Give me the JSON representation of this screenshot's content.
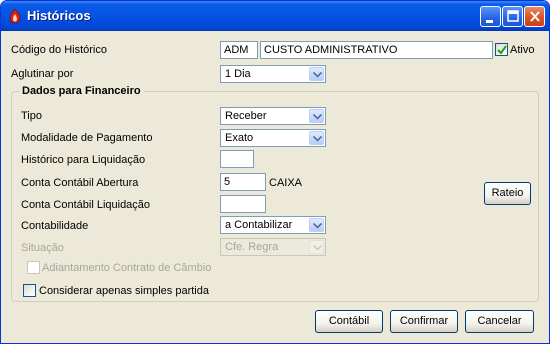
{
  "window": {
    "title": "Históricos"
  },
  "codigo": {
    "label": "Código do Histórico",
    "code": "ADM",
    "description": "CUSTO ADMINISTRATIVO",
    "ativo_label": "Ativo",
    "ativo_checked": true
  },
  "aglutinar": {
    "label": "Aglutinar por",
    "value": "1 Dia"
  },
  "group": {
    "title": "Dados para Financeiro",
    "tipo": {
      "label": "Tipo",
      "value": "Receber"
    },
    "modalidade": {
      "label": "Modalidade de Pagamento",
      "value": "Exato"
    },
    "historico_liquidacao": {
      "label": "Histórico para Liquidação",
      "value": ""
    },
    "conta_abertura": {
      "label": "Conta Contábil Abertura",
      "value": "5",
      "name": "CAIXA"
    },
    "conta_liquidacao": {
      "label": "Conta Contábil Liquidação",
      "value": ""
    },
    "contabilidade": {
      "label": "Contabilidade",
      "value": "a Contabilizar"
    },
    "situacao": {
      "label": "Situação",
      "value": "Cfe. Regra"
    },
    "adiantamento": {
      "label": "Adiantamento Contrato de Câmbio",
      "checked": false
    },
    "rateio_button": "Rateio"
  },
  "considerar": {
    "label": "Considerar apenas simples partida",
    "checked": false
  },
  "buttons": {
    "contabil": "Contábil",
    "confirmar": "Confirmar",
    "cancelar": "Cancelar"
  },
  "icons": {
    "app": "app-flame-icon",
    "minimize": "minimize-icon",
    "maximize": "maximize-icon",
    "close": "close-icon",
    "dropdown": "chevron-down-icon",
    "check": "checkmark-icon"
  },
  "colors": {
    "titlebar": "#0553e3",
    "window_bg": "#ece9d8",
    "input_border": "#7f9db9",
    "disabled_text": "#a7a69b"
  }
}
